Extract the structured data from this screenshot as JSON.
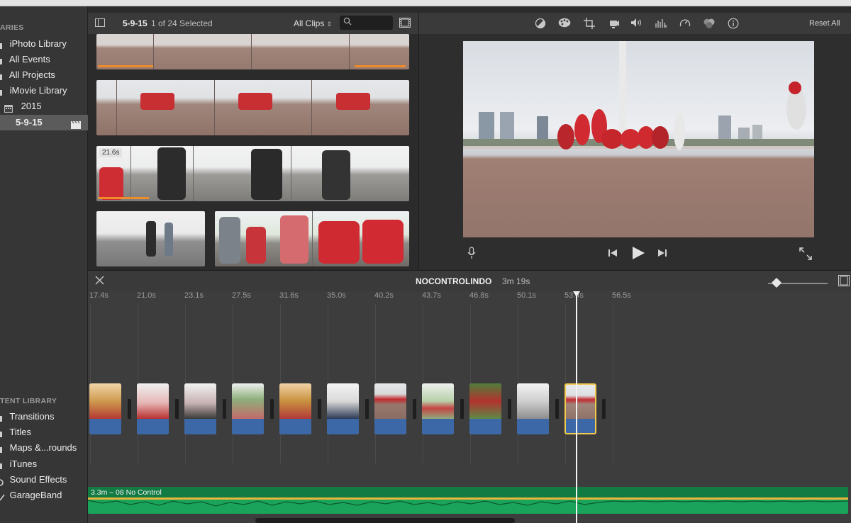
{
  "sidebar": {
    "libraries_heading": "ARIES",
    "library_items": [
      {
        "label": "iPhoto Library",
        "icon": "star-icon"
      },
      {
        "label": "All Events",
        "icon": "star-icon"
      },
      {
        "label": "All Projects",
        "icon": "star-icon"
      },
      {
        "label": "iMovie Library",
        "icon": "star-icon"
      },
      {
        "label": "2015",
        "icon": "calendar-icon"
      },
      {
        "label": "5-9-15",
        "icon": "clapper-icon"
      }
    ],
    "content_heading": "TENT LIBRARY",
    "content_items": [
      {
        "label": "Transitions",
        "icon": "transitions-icon"
      },
      {
        "label": "Titles",
        "icon": "titles-icon"
      },
      {
        "label": "Maps &...rounds",
        "icon": "maps-icon"
      },
      {
        "label": "iTunes",
        "icon": "music-icon"
      },
      {
        "label": "Sound Effects",
        "icon": "sound-effects-icon"
      },
      {
        "label": "GarageBand",
        "icon": "guitar-icon"
      }
    ]
  },
  "browser": {
    "event_name": "5-9-15",
    "selection": "1 of 24 Selected",
    "filter": "All Clips",
    "search_placeholder": "",
    "clip_badge": "21.6s"
  },
  "viewer": {
    "reset_label": "Reset All"
  },
  "timeline": {
    "project_name": "NOCONTROLINDO",
    "project_duration": "3m 19s",
    "ticks": [
      "17.4s",
      "21.0s",
      "23.1s",
      "27.5s",
      "31.6s",
      "35.0s",
      "40.2s",
      "43.7s",
      "46.8s",
      "50.1s",
      "53.4s",
      "56.5s"
    ],
    "music_label": "3.3m – 08 No Control",
    "zoom_level": 0.14
  },
  "colors": {
    "accent_orange": "#f08c2a",
    "audio_blue": "#3c68a8",
    "music_green": "#1aa35a",
    "selected_yellow": "#f2c94c"
  }
}
